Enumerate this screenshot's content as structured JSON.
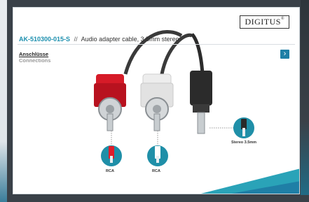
{
  "logo": "DIGITUS",
  "header": {
    "sku": "AK-510300-015-S",
    "separator": "//",
    "title": "Audio adapter cable, 3.5mm stereo"
  },
  "section": {
    "label_de": "Anschlüsse",
    "label_en": "Connections"
  },
  "nav": {
    "next_icon": "chevron-right-icon",
    "next_glyph": "›"
  },
  "connectors": [
    {
      "label": "RCA",
      "color": "#e11d2a"
    },
    {
      "label": "RCA",
      "color": "#f2f2f2"
    },
    {
      "label": "Stereo 3.5mm",
      "color": "#2a2a2a"
    }
  ],
  "colors": {
    "accent": "#1f7fa6",
    "badge": "#1f8fa8",
    "teal_corner": "#2aa3b8"
  }
}
